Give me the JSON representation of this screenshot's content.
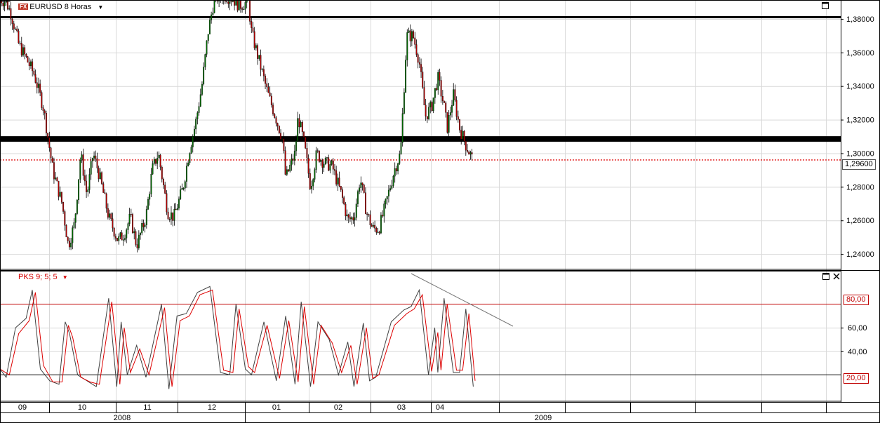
{
  "price_panel": {
    "title": "EURUSD 8 Horas",
    "fx_badge": "FX",
    "current_price_label": "1,29600",
    "y_tick_labels": [
      "1,38000",
      "1,36000",
      "1,34000",
      "1,32000",
      "1,30000",
      "1,28000",
      "1,26000",
      "1,24000"
    ]
  },
  "oscillator_panel": {
    "title": "PKS 9; 5; 5",
    "level_labels": [
      "80,00",
      "20,00"
    ],
    "y_tick_labels": [
      "60,00",
      "40,00"
    ]
  },
  "time_axis": {
    "month_labels": [
      "09",
      "10",
      "11",
      "12",
      "01",
      "02",
      "03",
      "04"
    ],
    "year_labels": [
      "2008",
      "2009"
    ]
  },
  "colors": {
    "up_candle": "#006600",
    "down_candle": "#aa0000",
    "price_dotted_line": "#dd0000",
    "oscillator_fast": "#404040",
    "oscillator_slow": "#dd0000",
    "level_line": "#c00000"
  },
  "icons": {
    "maximize": "maximize-icon",
    "close": "close-icon",
    "dropdown": "dropdown-arrow-icon"
  },
  "chart_data": [
    {
      "type": "candlestick",
      "title": "EURUSD 8 Horas",
      "x_categories": [
        "09",
        "10",
        "11",
        "12",
        "01",
        "02",
        "03",
        "04"
      ],
      "ylim": [
        1.232,
        1.39
      ],
      "grid": true,
      "horizontal_lines": [
        1.381,
        1.3085
      ],
      "current_price": 1.296,
      "close_path": [
        [
          0,
          1.392
        ],
        [
          0.1,
          1.39
        ],
        [
          0.18,
          1.383
        ],
        [
          0.3,
          1.365
        ],
        [
          0.4,
          1.358
        ],
        [
          0.55,
          1.347
        ],
        [
          0.7,
          1.327
        ],
        [
          0.85,
          1.29
        ],
        [
          1.0,
          1.27
        ],
        [
          1.1,
          1.245
        ],
        [
          1.2,
          1.258
        ],
        [
          1.3,
          1.3
        ],
        [
          1.4,
          1.275
        ],
        [
          1.5,
          1.3
        ],
        [
          1.6,
          1.287
        ],
        [
          1.75,
          1.262
        ],
        [
          1.9,
          1.248
        ],
        [
          2.0,
          1.252
        ],
        [
          2.1,
          1.262
        ],
        [
          2.2,
          1.245
        ],
        [
          2.35,
          1.262
        ],
        [
          2.45,
          1.29
        ],
        [
          2.55,
          1.3
        ],
        [
          2.6,
          1.288
        ],
        [
          2.7,
          1.265
        ],
        [
          2.8,
          1.262
        ],
        [
          2.95,
          1.28
        ],
        [
          3.05,
          1.302
        ],
        [
          3.15,
          1.318
        ],
        [
          3.25,
          1.34
        ],
        [
          3.35,
          1.372
        ],
        [
          3.45,
          1.392
        ],
        [
          3.6,
          1.394
        ],
        [
          3.75,
          1.392
        ],
        [
          3.85,
          1.388
        ],
        [
          4.0,
          1.39
        ],
        [
          4.05,
          1.372
        ],
        [
          4.15,
          1.358
        ],
        [
          4.3,
          1.337
        ],
        [
          4.45,
          1.32
        ],
        [
          4.55,
          1.308
        ],
        [
          4.6,
          1.285
        ],
        [
          4.75,
          1.3
        ],
        [
          4.8,
          1.322
        ],
        [
          4.9,
          1.305
        ],
        [
          5.0,
          1.28
        ],
        [
          5.1,
          1.3
        ],
        [
          5.2,
          1.295
        ],
        [
          5.35,
          1.292
        ],
        [
          5.5,
          1.275
        ],
        [
          5.6,
          1.26
        ],
        [
          5.7,
          1.262
        ],
        [
          5.8,
          1.285
        ],
        [
          5.9,
          1.265
        ],
        [
          6.0,
          1.255
        ],
        [
          6.1,
          1.255
        ],
        [
          6.2,
          1.268
        ],
        [
          6.35,
          1.29
        ],
        [
          6.45,
          1.3
        ],
        [
          6.55,
          1.37
        ],
        [
          6.65,
          1.37
        ],
        [
          6.75,
          1.355
        ],
        [
          6.85,
          1.322
        ],
        [
          6.95,
          1.328
        ],
        [
          7.05,
          1.345
        ],
        [
          7.15,
          1.328
        ],
        [
          7.2,
          1.315
        ],
        [
          7.3,
          1.335
        ],
        [
          7.4,
          1.315
        ],
        [
          7.5,
          1.305
        ],
        [
          7.6,
          1.297
        ]
      ]
    },
    {
      "type": "line",
      "title": "PKS 9; 5; 5",
      "ylim": [
        0,
        100
      ],
      "levels": [
        80,
        20
      ],
      "series": [
        {
          "values": [
            [
              0,
              25
            ],
            [
              0.1,
              18
            ],
            [
              0.25,
              60
            ],
            [
              0.42,
              68
            ],
            [
              0.52,
              92
            ],
            [
              0.65,
              25
            ],
            [
              0.8,
              15
            ],
            [
              0.95,
              12
            ],
            [
              1.05,
              65
            ],
            [
              1.12,
              55
            ],
            [
              1.25,
              20
            ],
            [
              1.4,
              15
            ],
            [
              1.55,
              10
            ],
            [
              1.75,
              85
            ],
            [
              1.88,
              10
            ],
            [
              1.95,
              65
            ],
            [
              2.05,
              20
            ],
            [
              2.2,
              45
            ],
            [
              2.35,
              18
            ],
            [
              2.6,
              80
            ],
            [
              2.72,
              8
            ],
            [
              2.85,
              70
            ],
            [
              3.0,
              72
            ],
            [
              3.18,
              90
            ],
            [
              3.38,
              95
            ],
            [
              3.55,
              22
            ],
            [
              3.7,
              20
            ],
            [
              3.8,
              80
            ],
            [
              3.95,
              25
            ],
            [
              4.05,
              20
            ],
            [
              4.25,
              65
            ],
            [
              4.45,
              15
            ],
            [
              4.6,
              70
            ],
            [
              4.75,
              12
            ],
            [
              4.85,
              82
            ],
            [
              5.0,
              10
            ],
            [
              5.12,
              65
            ],
            [
              5.3,
              50
            ],
            [
              5.45,
              20
            ],
            [
              5.6,
              48
            ],
            [
              5.7,
              10
            ],
            [
              5.85,
              64
            ],
            [
              5.95,
              15
            ],
            [
              6.05,
              18
            ],
            [
              6.3,
              65
            ],
            [
              6.5,
              75
            ],
            [
              6.62,
              78
            ],
            [
              6.75,
              92
            ],
            [
              6.9,
              20
            ],
            [
              7.0,
              60
            ],
            [
              7.05,
              22
            ],
            [
              7.15,
              85
            ],
            [
              7.3,
              22
            ],
            [
              7.4,
              22
            ],
            [
              7.5,
              76
            ],
            [
              7.62,
              10
            ]
          ]
        },
        {
          "values": [
            [
              0,
              25
            ],
            [
              0.15,
              20
            ],
            [
              0.3,
              55
            ],
            [
              0.47,
              66
            ],
            [
              0.57,
              90
            ],
            [
              0.7,
              28
            ],
            [
              0.85,
              14
            ],
            [
              1.0,
              14
            ],
            [
              1.1,
              62
            ],
            [
              1.17,
              52
            ],
            [
              1.3,
              18
            ],
            [
              1.45,
              14
            ],
            [
              1.6,
              12
            ],
            [
              1.8,
              82
            ],
            [
              1.93,
              12
            ],
            [
              2.0,
              60
            ],
            [
              2.1,
              22
            ],
            [
              2.25,
              42
            ],
            [
              2.4,
              20
            ],
            [
              2.65,
              77
            ],
            [
              2.77,
              10
            ],
            [
              2.9,
              66
            ],
            [
              3.05,
              70
            ],
            [
              3.22,
              88
            ],
            [
              3.42,
              92
            ],
            [
              3.6,
              24
            ],
            [
              3.75,
              22
            ],
            [
              3.85,
              76
            ],
            [
              4.0,
              27
            ],
            [
              4.1,
              22
            ],
            [
              4.3,
              62
            ],
            [
              4.5,
              17
            ],
            [
              4.65,
              66
            ],
            [
              4.8,
              14
            ],
            [
              4.9,
              78
            ],
            [
              5.05,
              12
            ],
            [
              5.17,
              62
            ],
            [
              5.35,
              47
            ],
            [
              5.5,
              22
            ],
            [
              5.65,
              45
            ],
            [
              5.75,
              12
            ],
            [
              5.9,
              60
            ],
            [
              6.0,
              17
            ],
            [
              6.1,
              20
            ],
            [
              6.35,
              62
            ],
            [
              6.55,
              72
            ],
            [
              6.67,
              76
            ],
            [
              6.8,
              88
            ],
            [
              6.95,
              23
            ],
            [
              7.05,
              56
            ],
            [
              7.1,
              24
            ],
            [
              7.2,
              80
            ],
            [
              7.35,
              24
            ],
            [
              7.45,
              24
            ],
            [
              7.55,
              72
            ],
            [
              7.65,
              15
            ]
          ]
        }
      ]
    }
  ]
}
